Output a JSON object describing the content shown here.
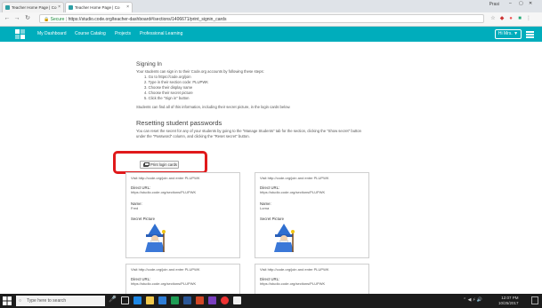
{
  "browser": {
    "tabs": [
      {
        "label": "Teacher Home Page | Co"
      },
      {
        "label": "Teacher Home Page | Co"
      }
    ],
    "user_chip": "Prasi",
    "window_controls": [
      "–",
      "▢",
      "✕"
    ],
    "address": {
      "secure_label": "Secure",
      "url": "https://studio.code.org/teacher-dashboard#/sections/1406671/print_signin_cards"
    }
  },
  "site": {
    "nav": [
      "My Dashboard",
      "Course Catalog",
      "Projects",
      "Professional Learning"
    ],
    "user_button": "Hi Mrs. ▼"
  },
  "signing_in": {
    "title": "Signing In",
    "intro": "Your students can sign in to their Code.org accounts by following these steps:",
    "steps": [
      "1. Go to https://code.org/join",
      "2. Type in their section code: PLUPWK",
      "3. Choose their display name",
      "4. Choose their secret picture",
      "5. Click the \"Sign in\" button"
    ],
    "footer": "Students can find all of this information, including their secret picture, in the login cards below."
  },
  "resetting": {
    "title": "Resetting student passwords",
    "line1": "You can reset the secret for any of your students by going to the \"Manage Students\" tab for the section, clicking the \"Show secret\" button",
    "line2": "under the \"Password\" column, and clicking the \"Reset secret\" button."
  },
  "print_button": "Print login cards",
  "cards": [
    {
      "visit": "Visit http://code.org/join and enter PLUPWK",
      "direct_label": "Direct URL:",
      "direct_url": "https://studio.code.org/sections/PLUPWK",
      "name_label": "Name:",
      "name": "Fred",
      "picture_label": "Secret Picture"
    },
    {
      "visit": "Visit http://code.org/join and enter PLUPWK",
      "direct_label": "Direct URL:",
      "direct_url": "https://studio.code.org/sections/PLUPWK",
      "name_label": "Name:",
      "name": "Lorna",
      "picture_label": "Secret Picture"
    },
    {
      "visit": "Visit http://code.org/join and enter PLUPWK",
      "direct_label": "Direct URL:",
      "direct_url": "https://studio.code.org/sections/PLUPWK"
    },
    {
      "visit": "Visit http://code.org/join and enter PLUPWK",
      "direct_label": "Direct URL:",
      "direct_url": "https://studio.code.org/sections/PLUPWK"
    }
  ],
  "taskbar": {
    "search_placeholder": "Type here to search",
    "time": "12:07 PM",
    "date": "10/25/2017"
  }
}
